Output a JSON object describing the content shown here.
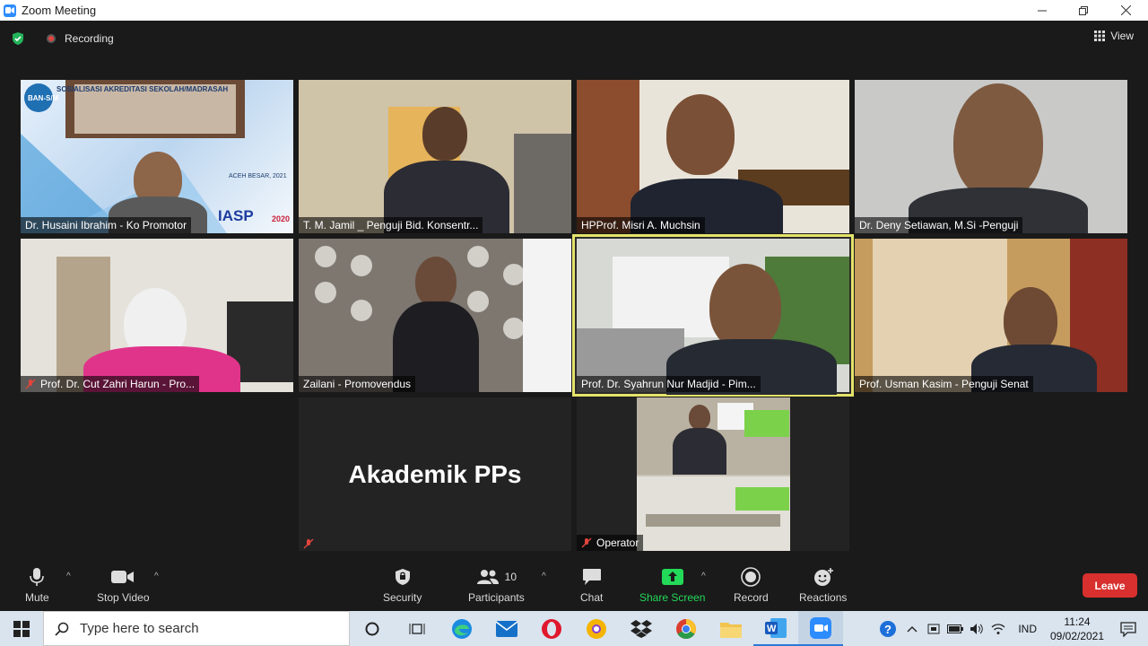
{
  "window": {
    "title": "Zoom Meeting"
  },
  "meeting": {
    "recording_label": "Recording",
    "view_label": "View",
    "participants": [
      {
        "name": "Dr. Husaini Ibrahim - Ko Promotor",
        "muted": false
      },
      {
        "name": "T. M. Jamil _ Penguji Bid. Konsentr...",
        "muted": false
      },
      {
        "name": "HPProf. Misri A. Muchsin",
        "muted": false
      },
      {
        "name": "Dr. Deny Setiawan, M.Si -Penguji",
        "muted": false
      },
      {
        "name": "Prof. Dr. Cut Zahri Harun - Pro...",
        "muted": true
      },
      {
        "name": "Zailani - Promovendus",
        "muted": false
      },
      {
        "name": "Prof. Dr. Syahrun Nur Madjid - Pim...",
        "muted": false,
        "active_speaker": true
      },
      {
        "name": "Prof. Usman Kasim - Penguji Senat",
        "muted": false
      },
      {
        "name": "Akademik PPs",
        "muted": true,
        "video_off": true
      },
      {
        "name": "Operator",
        "muted": true
      }
    ],
    "tile1_overlay": {
      "header": "SOSIALISASI AKREDITASI SEKOLAH/MADRASAH",
      "location": "ACEH BESAR, 2021",
      "logo": "IASP",
      "logo_year": "2020",
      "org": "BAN-S/M"
    }
  },
  "toolbar": {
    "mute": "Mute",
    "stop_video": "Stop Video",
    "security": "Security",
    "participants": "Participants",
    "participants_count": "10",
    "chat": "Chat",
    "share_screen": "Share Screen",
    "record": "Record",
    "reactions": "Reactions",
    "leave": "Leave"
  },
  "taskbar": {
    "search_placeholder": "Type here to search",
    "language": "IND",
    "time": "11:24",
    "date": "09/02/2021"
  },
  "colors": {
    "share_green": "#23d959",
    "leave_red": "#d7302e",
    "active_speaker": "#e4e36a",
    "muted_red": "#e0443e"
  }
}
